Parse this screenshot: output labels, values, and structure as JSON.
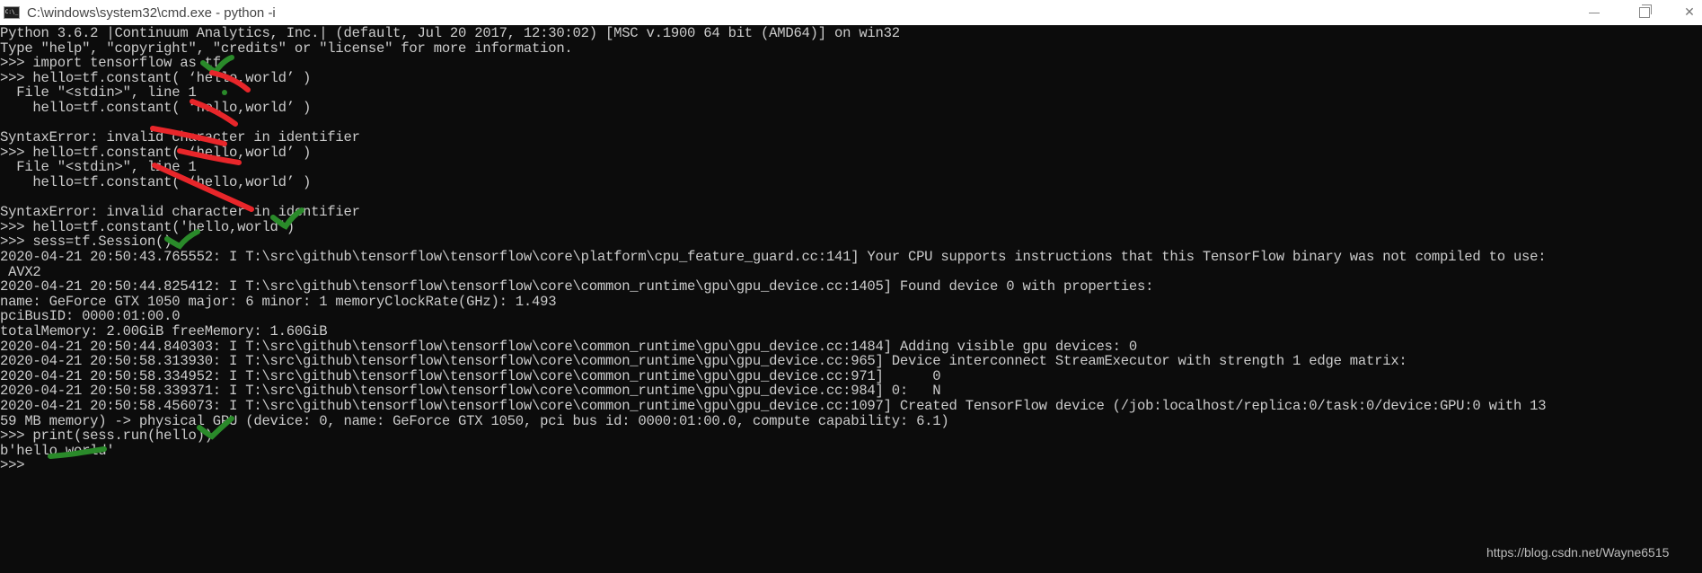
{
  "window": {
    "title": "C:\\windows\\system32\\cmd.exe - python  -i",
    "icon": "console-icon",
    "icon_text": "C:\\_",
    "controls": [
      "minimize",
      "maximize",
      "close"
    ]
  },
  "console": {
    "lines": [
      "Python 3.6.2 |Continuum Analytics, Inc.| (default, Jul 20 2017, 12:30:02) [MSC v.1900 64 bit (AMD64)] on win32",
      "Type \"help\", \"copyright\", \"credits\" or \"license\" for more information.",
      ">>> import tensorflow as tf",
      ">>> hello=tf.constant( ‘hello,world’ )",
      "  File \"<stdin>\", line 1",
      "    hello=tf.constant( ‘hello,world’ )",
      "",
      "SyntaxError: invalid character in identifier",
      ">>> hello=tf.constant( ‘hello,world’ )",
      "  File \"<stdin>\", line 1",
      "    hello=tf.constant( ‘hello,world’ )",
      "",
      "SyntaxError: invalid character in identifier",
      ">>> hello=tf.constant('hello,world')",
      ">>> sess=tf.Session()",
      "2020-04-21 20:50:43.765552: I T:\\src\\github\\tensorflow\\tensorflow\\core\\platform\\cpu_feature_guard.cc:141] Your CPU supports instructions that this TensorFlow binary was not compiled to use:",
      " AVX2",
      "2020-04-21 20:50:44.825412: I T:\\src\\github\\tensorflow\\tensorflow\\core\\common_runtime\\gpu\\gpu_device.cc:1405] Found device 0 with properties:",
      "name: GeForce GTX 1050 major: 6 minor: 1 memoryClockRate(GHz): 1.493",
      "pciBusID: 0000:01:00.0",
      "totalMemory: 2.00GiB freeMemory: 1.60GiB",
      "2020-04-21 20:50:44.840303: I T:\\src\\github\\tensorflow\\tensorflow\\core\\common_runtime\\gpu\\gpu_device.cc:1484] Adding visible gpu devices: 0",
      "2020-04-21 20:50:58.313930: I T:\\src\\github\\tensorflow\\tensorflow\\core\\common_runtime\\gpu\\gpu_device.cc:965] Device interconnect StreamExecutor with strength 1 edge matrix:",
      "2020-04-21 20:50:58.334952: I T:\\src\\github\\tensorflow\\tensorflow\\core\\common_runtime\\gpu\\gpu_device.cc:971]      0",
      "2020-04-21 20:50:58.339371: I T:\\src\\github\\tensorflow\\tensorflow\\core\\common_runtime\\gpu\\gpu_device.cc:984] 0:   N",
      "2020-04-21 20:50:58.456073: I T:\\src\\github\\tensorflow\\tensorflow\\core\\common_runtime\\gpu\\gpu_device.cc:1097] Created TensorFlow device (/job:localhost/replica:0/task:0/device:GPU:0 with 13",
      "59 MB memory) -> physical GPU (device: 0, name: GeForce GTX 1050, pci bus id: 0000:01:00.0, compute capability: 6.1)",
      ">>> print(sess.run(hello))",
      "b'hello,world'",
      ">>> "
    ]
  },
  "annotations": {
    "checkmark_color": "#2a8a2a",
    "strike_color": "#e8262a",
    "checkmarks": [
      "import-line",
      "constant-fixed-line",
      "session-line",
      "print-line"
    ],
    "strikes": [
      "bad-quote-1",
      "bad-quote-2",
      "bad-quote-3",
      "bad-quote-4",
      "bad-quote-5"
    ],
    "underline": "output-hello-world"
  },
  "watermark": "https://blog.csdn.net/Wayne6515",
  "colors": {
    "console_bg": "#0c0c0c",
    "console_fg": "#cccccc",
    "titlebar_bg": "#ffffff"
  }
}
